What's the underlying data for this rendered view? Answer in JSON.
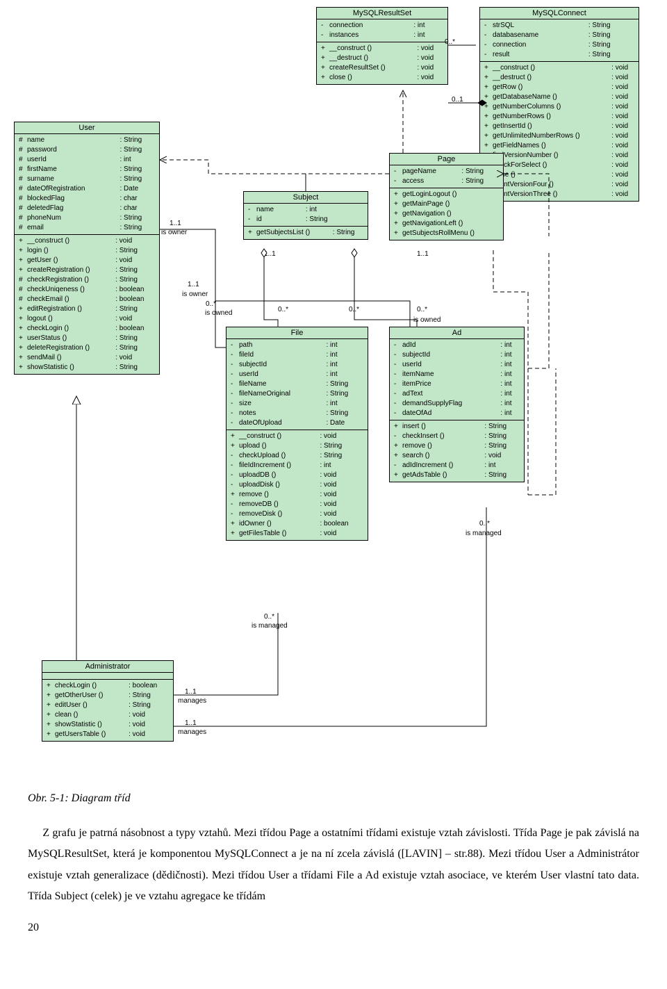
{
  "classes": {
    "User": {
      "title": "User",
      "attrs": [
        [
          "#",
          "name",
          "String"
        ],
        [
          "#",
          "password",
          "String"
        ],
        [
          "#",
          "userId",
          "int"
        ],
        [
          "#",
          "firstName",
          "String"
        ],
        [
          "#",
          "surname",
          "String"
        ],
        [
          "#",
          "dateOfRegistration",
          "Date"
        ],
        [
          "#",
          "blockedFlag",
          "char"
        ],
        [
          "#",
          "deletedFlag",
          "char"
        ],
        [
          "#",
          "phoneNum",
          "String"
        ],
        [
          "#",
          "email",
          "String"
        ]
      ],
      "ops": [
        [
          "+",
          "__construct ()",
          "void"
        ],
        [
          "+",
          "login ()",
          "String"
        ],
        [
          "+",
          "getUser ()",
          "void"
        ],
        [
          "+",
          "createRegistration ()",
          "String"
        ],
        [
          "#",
          "checkRegistration ()",
          "String"
        ],
        [
          "#",
          "checkUniqeness ()",
          "boolean"
        ],
        [
          "#",
          "checkEmail ()",
          "boolean"
        ],
        [
          "+",
          "editRegistration ()",
          "String"
        ],
        [
          "+",
          "logout ()",
          "void"
        ],
        [
          "+",
          "checkLogin ()",
          "boolean"
        ],
        [
          "+",
          "userStatus ()",
          "String"
        ],
        [
          "+",
          "deleteRegistration ()",
          "String"
        ],
        [
          "+",
          "sendMail ()",
          "void"
        ],
        [
          "+",
          "showStatistic ()",
          "String"
        ]
      ]
    },
    "MySQLResultSet": {
      "title": "MySQLResultSet",
      "attrs": [
        [
          "-",
          "connection",
          "int"
        ],
        [
          "-",
          "instances",
          "int"
        ]
      ],
      "ops": [
        [
          "+",
          "__construct ()",
          "void"
        ],
        [
          "+",
          "__destruct ()",
          "void"
        ],
        [
          "+",
          "createResultSet ()",
          "void"
        ],
        [
          "+",
          "close ()",
          "void"
        ]
      ]
    },
    "MySQLConnect": {
      "title": "MySQLConnect",
      "attrs": [
        [
          "-",
          "strSQL",
          "String"
        ],
        [
          "-",
          "databasename",
          "String"
        ],
        [
          "-",
          "connection",
          "String"
        ],
        [
          "-",
          "result",
          "String"
        ]
      ],
      "ops": [
        [
          "+",
          "__construct ()",
          "void"
        ],
        [
          "+",
          "__destruct ()",
          "void"
        ],
        [
          "+",
          "getRow ()",
          "void"
        ],
        [
          "+",
          "getDatabaseName ()",
          "void"
        ],
        [
          "+",
          "getNumberColumns ()",
          "void"
        ],
        [
          "+",
          "getNumberRows ()",
          "void"
        ],
        [
          "+",
          "getInsertId ()",
          "void"
        ],
        [
          "+",
          "getUnlimitedNumberRows ()",
          "void"
        ],
        [
          "+",
          "getFieldNames ()",
          "void"
        ],
        [
          "+",
          "findVersionNumber ()",
          "void"
        ],
        [
          "-",
          "checkForSelect ()",
          "void"
        ],
        [
          "-",
          "close ()",
          "void"
        ],
        [
          "-",
          "countVersionFour ()",
          "void"
        ],
        [
          "-",
          "countVersionThree ()",
          "void"
        ]
      ]
    },
    "Subject": {
      "title": "Subject",
      "attrs": [
        [
          "-",
          "name",
          "int"
        ],
        [
          "-",
          "id",
          "String"
        ]
      ],
      "ops": [
        [
          "+",
          "getSubjectsList ()",
          "String"
        ]
      ]
    },
    "Page": {
      "title": "Page",
      "attrs": [
        [
          "-",
          "pageName",
          "String"
        ],
        [
          "-",
          "access",
          "String"
        ]
      ],
      "ops": [
        [
          "+",
          "getLoginLogout ()",
          ""
        ],
        [
          "+",
          "getMainPage ()",
          ""
        ],
        [
          "+",
          "getNavigation ()",
          ""
        ],
        [
          "+",
          "getNavigationLeft ()",
          ""
        ],
        [
          "+",
          "getSubjectsRollMenu ()",
          ""
        ]
      ]
    },
    "File": {
      "title": "File",
      "attrs": [
        [
          "-",
          "path",
          "int"
        ],
        [
          "-",
          "fileId",
          "int"
        ],
        [
          "-",
          "subjectId",
          "int"
        ],
        [
          "-",
          "userId",
          "int"
        ],
        [
          "-",
          "fileName",
          "String"
        ],
        [
          "-",
          "fileNameOriginal",
          "String"
        ],
        [
          "-",
          "size",
          "int"
        ],
        [
          "-",
          "notes",
          "String"
        ],
        [
          "-",
          "dateOfUpload",
          "Date"
        ]
      ],
      "ops": [
        [
          "+",
          "__construct ()",
          "void"
        ],
        [
          "+",
          "upload ()",
          "String"
        ],
        [
          "-",
          "checkUpload ()",
          "String"
        ],
        [
          "-",
          "fileIdIncrement ()",
          "int"
        ],
        [
          "-",
          "uploadDB ()",
          "void"
        ],
        [
          "-",
          "uploadDisk ()",
          "void"
        ],
        [
          "+",
          "remove ()",
          "void"
        ],
        [
          "-",
          "removeDB ()",
          "void"
        ],
        [
          "-",
          "removeDisk ()",
          "void"
        ],
        [
          "+",
          "idOwner ()",
          "boolean"
        ],
        [
          "+",
          "getFilesTable ()",
          "void"
        ]
      ]
    },
    "Ad": {
      "title": "Ad",
      "attrs": [
        [
          "-",
          "adId",
          "int"
        ],
        [
          "-",
          "subjectId",
          "int"
        ],
        [
          "-",
          "userId",
          "int"
        ],
        [
          "-",
          "itemName",
          "int"
        ],
        [
          "-",
          "itemPrice",
          "int"
        ],
        [
          "-",
          "adText",
          "int"
        ],
        [
          "-",
          "demandSupplyFlag",
          "int"
        ],
        [
          "-",
          "dateOfAd",
          "int"
        ]
      ],
      "ops": [
        [
          "+",
          "insert ()",
          "String"
        ],
        [
          "-",
          "checkInsert ()",
          "String"
        ],
        [
          "+",
          "remove ()",
          "String"
        ],
        [
          "+",
          "search ()",
          "void"
        ],
        [
          "-",
          "adIdIncrement ()",
          "int"
        ],
        [
          "+",
          "getAdsTable ()",
          "String"
        ]
      ]
    },
    "Administrator": {
      "title": "Administrator",
      "attrs": [],
      "ops": [
        [
          "+",
          "checkLogin ()",
          "boolean"
        ],
        [
          "+",
          "getOtherUser ()",
          "String"
        ],
        [
          "+",
          "editUser ()",
          "String"
        ],
        [
          "+",
          "clean ()",
          "void"
        ],
        [
          "+",
          "showStatistic ()",
          "void"
        ],
        [
          "+",
          "getUsersTable ()",
          "void"
        ]
      ]
    }
  },
  "labels": {
    "l1": "1..1",
    "own": "is owner",
    "isowned": "is owned",
    "zeroStar": "0..*",
    "zeroOne": "0..1",
    "managed": "is managed",
    "manages": "manages",
    "oneone": "1..1"
  },
  "caption": "Obr. 5-1: Diagram tříd",
  "bodytext": "Z grafu je patrná násobnost a typy vztahů. Mezi třídou Page a ostatními třídami existuje vztah závislosti. Třída Page je pak závislá na MySQLResultSet, která je komponentou MySQLConnect a je na ní zcela závislá ([LAVIN] – str.88). Mezi třídou User a Administrátor existuje vztah generalizace (dědičnosti). Mezi třídou User a třídami File a Ad existuje vztah asociace, ve kterém User vlastní tato data. Třída Subject (celek) je ve vztahu agregace ke třídám",
  "pagenum": "20"
}
